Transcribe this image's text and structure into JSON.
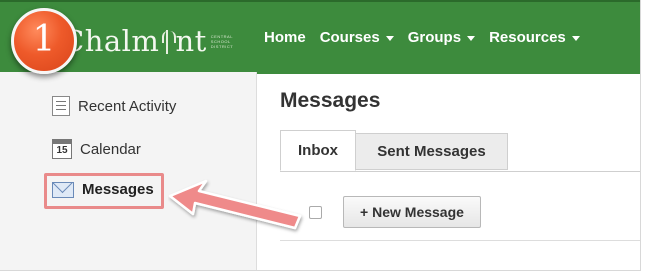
{
  "step_badge": "1",
  "logo": {
    "text_before": "Chalm",
    "text_after": "nt",
    "district_text": "Central School District"
  },
  "nav": {
    "items": [
      {
        "label": "Home",
        "has_dropdown": false
      },
      {
        "label": "Courses",
        "has_dropdown": true
      },
      {
        "label": "Groups",
        "has_dropdown": true
      },
      {
        "label": "Resources",
        "has_dropdown": true
      }
    ]
  },
  "sidebar": {
    "items": [
      {
        "label": "Recent Activity",
        "icon": "list-icon"
      },
      {
        "label": "Calendar",
        "icon": "calendar-icon",
        "icon_text": "15"
      },
      {
        "label": "Messages",
        "icon": "envelope-icon",
        "active": true
      }
    ]
  },
  "main": {
    "title": "Messages",
    "tabs": [
      {
        "label": "Inbox",
        "selected": true
      },
      {
        "label": "Sent Messages",
        "selected": false
      }
    ],
    "new_message_button": "+ New Message"
  },
  "colors": {
    "nav_bg": "#3d8b3d",
    "badge": "#ee5a2a",
    "highlight": "#e98a8a"
  }
}
